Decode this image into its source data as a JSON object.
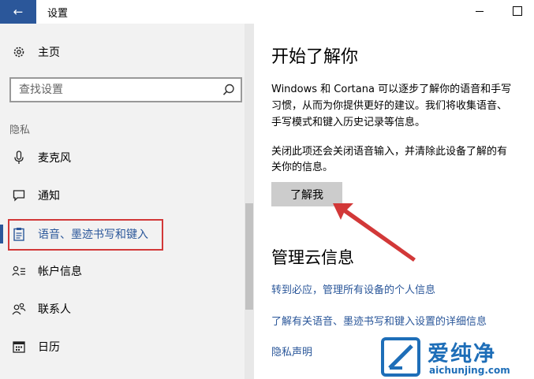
{
  "window": {
    "title": "设置"
  },
  "sidebar": {
    "home_label": "主页",
    "search_placeholder": "查找设置",
    "section_header": "隐私",
    "items": [
      {
        "label": "麦克风",
        "icon": "microphone-icon"
      },
      {
        "label": "通知",
        "icon": "notification-icon"
      },
      {
        "label": "语音、墨迹书写和键入",
        "icon": "clipboard-icon",
        "active": true
      },
      {
        "label": "帐户信息",
        "icon": "account-info-icon"
      },
      {
        "label": "联系人",
        "icon": "contacts-icon"
      },
      {
        "label": "日历",
        "icon": "calendar-icon"
      }
    ]
  },
  "main": {
    "title": "开始了解你",
    "description_lines": [
      "Windows 和 Cortana 可以逐步了解你的语音和手写",
      "习惯，从而为你提供更好的建议。我们将收集语音、",
      "手写模式和键入历史记录等信息。"
    ],
    "note_lines": [
      "关闭此项还会关闭语音输入，并清除此设备了解的有",
      "关你的信息。"
    ],
    "button_label": "了解我",
    "section_title": "管理云信息",
    "links": [
      "转到必应，管理所有设备的个人信息",
      "了解有关语音、墨迹书写和键入设置的详细信息",
      "隐私声明"
    ]
  },
  "watermark": {
    "brand": "爱纯净",
    "url": "aichunjing.com"
  },
  "colors": {
    "accent": "#2b579a",
    "annotation_red": "#d23838",
    "watermark_blue": "#1e6eb8"
  }
}
